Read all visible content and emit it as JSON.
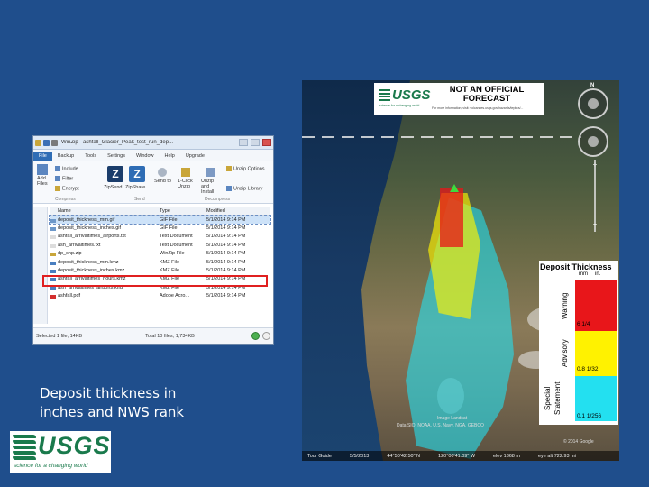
{
  "caption": {
    "line1": "Deposit thickness in",
    "line2": "inches and NWS rank"
  },
  "logo": {
    "text": "USGS",
    "tagline": "science for a changing world"
  },
  "winzip": {
    "title": "WinZip - ashfall_Glacier_Peak_test_run_dep...",
    "tabs": [
      "File",
      "Backup",
      "Tools",
      "Settings",
      "Window",
      "Help",
      "Upgrade"
    ],
    "ribbon": {
      "add_files": "Add Files",
      "include": "Include",
      "filter": "Filter",
      "encrypt": "Encrypt",
      "zipsend": "ZipSend",
      "zipshare": "ZipShare",
      "send_to": "Send to",
      "one_click_unzip": "1-Click Unzip",
      "unzip_and_install": "Unzip and Install",
      "unzip_options": "Unzip Options",
      "unzip_library": "Unzip Library",
      "group_compress": "Compress",
      "group_send": "Send",
      "group_decompress": "Decompress"
    },
    "columns": [
      "Name",
      "Type",
      "Modified"
    ],
    "files": [
      {
        "name": "deposit_thickness_mm.gif",
        "type": "GIF File",
        "modified": "5/1/2014 9:14 PM"
      },
      {
        "name": "deposit_thickness_inches.gif",
        "type": "GIF File",
        "modified": "5/1/2014 9:14 PM"
      },
      {
        "name": "ashfall_arrivaltimes_airports.txt",
        "type": "Text Document",
        "modified": "5/1/2014 9:14 PM"
      },
      {
        "name": "ash_arrivaltimes.txt",
        "type": "Text Document",
        "modified": "5/1/2014 9:14 PM"
      },
      {
        "name": "dp_shp.zip",
        "type": "WinZip File",
        "modified": "5/1/2014 9:14 PM"
      },
      {
        "name": "deposit_thickness_mm.kmz",
        "type": "KMZ File",
        "modified": "5/1/2014 9:14 PM"
      },
      {
        "name": "deposit_thickness_inches.kmz",
        "type": "KMZ File",
        "modified": "5/1/2014 9:14 PM"
      },
      {
        "name": "ashfall_arrivaltimes_hours.kmz",
        "type": "KMZ File",
        "modified": "5/1/2014 9:14 PM"
      },
      {
        "name": "ash_arrivaltimes_airports.kmz",
        "type": "KMZ File",
        "modified": "5/1/2014 9:14 PM"
      },
      {
        "name": "ashfall.pdf",
        "type": "Adobe Acro...",
        "modified": "5/1/2014 9:14 PM"
      }
    ],
    "status_left": "Selected 1 file, 14KB",
    "status_right": "Total 10 files, 1,734KB"
  },
  "map": {
    "forecast_title": "NOT AN OFFICIAL FORECAST",
    "banner_logo": "USGS",
    "banner_tagline": "science for a changing world",
    "banner_url": "For more information, visit: volcanoes.usgs.gov/hazards/tephra/...",
    "legend": {
      "title": "Deposit Thickness",
      "units": [
        "mm",
        "in."
      ],
      "bands": [
        {
          "rank": "Warning",
          "color": "#e8161a",
          "value": "6    1/4"
        },
        {
          "rank": "Advisory",
          "color": "#fff200",
          "value": "0.8  1/32"
        },
        {
          "rank": "Special Statement",
          "color": "#23e0f0",
          "value": "0.1  1/256"
        }
      ]
    },
    "attribution": "Image Landsat",
    "attribution2": "Data SIO, NOAA, U.S. Navy, NGA, GEBCO",
    "google": "© 2014 Google",
    "status": {
      "tour": "Tour Guide",
      "date": "5/5/2013",
      "lat": "44°50'42.50\" N",
      "lon": "120°00'41.09\" W",
      "elev": "elev 1368 m",
      "eye": "eye alt 722.93 mi"
    },
    "colors": {
      "warning": "#e8161a",
      "advisory": "#fff200",
      "special": "#23e0f0",
      "volcano": "#3ddc3d"
    }
  }
}
